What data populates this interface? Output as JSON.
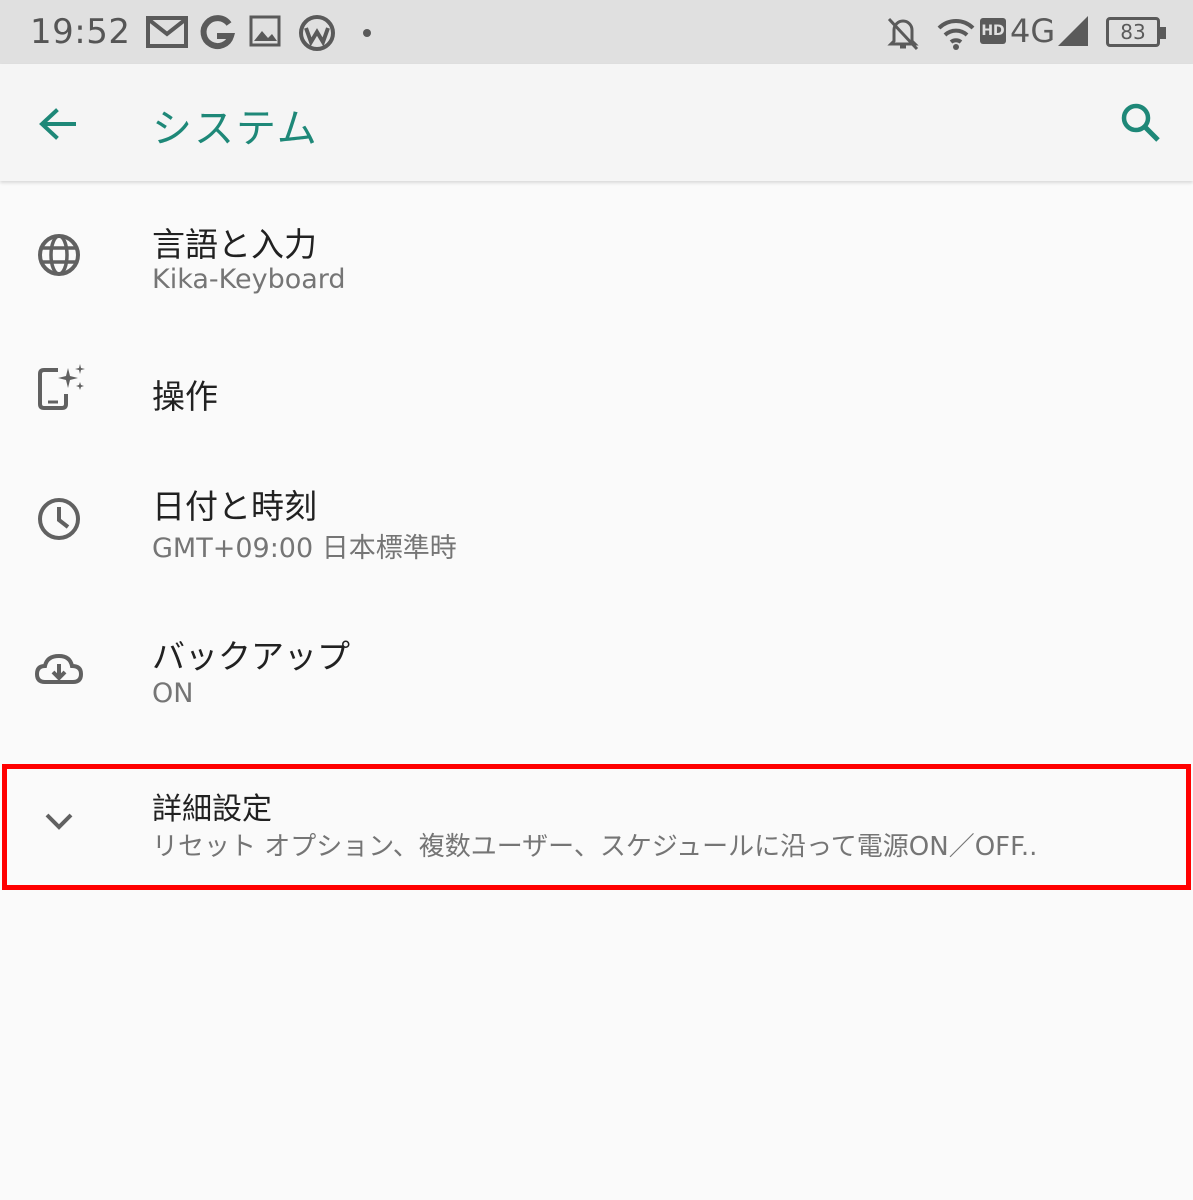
{
  "status_bar": {
    "time": "19:52",
    "network": "4G",
    "hd_badge": "HD",
    "battery": "83",
    "left_icons": [
      "gmail-icon",
      "google-icon",
      "image-icon",
      "weather-icon",
      "dot-icon"
    ],
    "right_icons": [
      "notifications-off-icon",
      "wifi-icon",
      "hd-badge-icon",
      "signal-icon",
      "battery-icon"
    ]
  },
  "app_bar": {
    "title": "システム",
    "accent_color": "#1e8878"
  },
  "settings": [
    {
      "title": "言語と入力",
      "subtitle": "Kika-Keyboard",
      "icon": "globe-icon"
    },
    {
      "title": "操作",
      "subtitle": "",
      "icon": "gesture-phone-icon"
    },
    {
      "title": "日付と時刻",
      "subtitle": "GMT+09:00 日本標準時",
      "icon": "clock-icon"
    },
    {
      "title": "バックアップ",
      "subtitle": "ON",
      "icon": "cloud-backup-icon"
    },
    {
      "title": "詳細設定",
      "subtitle": "リセット オプション、複数ユーザー、スケジュールに沿って電源ON／OFF..",
      "icon": "chevron-down-icon"
    }
  ],
  "highlight_color": "#ff0000"
}
